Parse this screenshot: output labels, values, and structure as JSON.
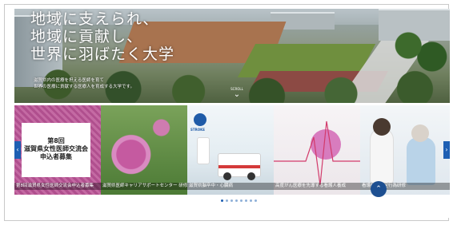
{
  "hero": {
    "headline": [
      "地域に支えられ、",
      "地域に貢献し、",
      "世界に羽ばたく大学"
    ],
    "subcopy": [
      "滋賀県内の医療を担える医師を育て",
      "世界の医療に貢献する医療人を育成する大学です。"
    ],
    "scroll_label": "SCROLL",
    "scroll_icon": "chevron-down-icon"
  },
  "carousel": {
    "slides": [
      {
        "card_lines": [
          "第8回",
          "滋賀県女性医師交流会",
          "申込者募集"
        ],
        "caption": "第8回滋賀県女性医師交流会申込者募集"
      },
      {
        "caption": "滋賀県医師キャリアサポートセンター 研修"
      },
      {
        "logo_text": "STROKE",
        "caption": "滋賀県脳卒中・心臓病"
      },
      {
        "caption": "高度がん医療を先導する看護人養成"
      },
      {
        "caption": "看護師の特定行為研修"
      }
    ],
    "prev_icon": "chevron-left-icon",
    "next_icon": "chevron-right-icon",
    "page_count": 8,
    "active_page": 0
  },
  "back_to_top_icon": "chevron-up-icon",
  "colors": {
    "accent": "#1e5fb3",
    "navy": "#1d4f91"
  }
}
